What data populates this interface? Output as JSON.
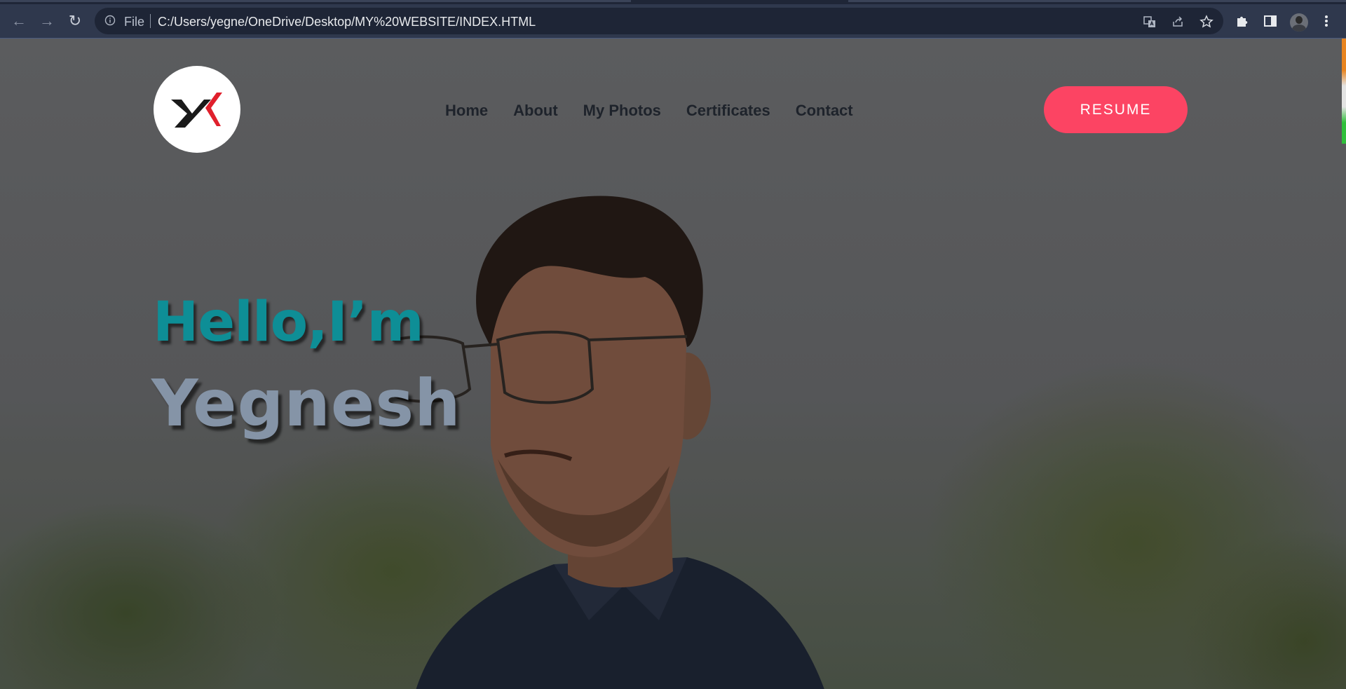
{
  "browser": {
    "back_label": "←",
    "forward_label": "→",
    "reload_label": "↻",
    "scheme_label": "File",
    "url": "C:/Users/yegne/OneDrive/Desktop/MY%20WEBSITE/INDEX.HTML",
    "icons": [
      "back-arrow-icon",
      "forward-arrow-icon",
      "reload-icon",
      "info-icon",
      "translate-icon",
      "share-icon",
      "star-icon",
      "puzzle-icon",
      "side-panel-icon",
      "profile-avatar",
      "kebab-menu-icon"
    ]
  },
  "site": {
    "logo_text": "YK",
    "nav": {
      "home": "Home",
      "about": "About",
      "photos": "My Photos",
      "certificates": "Certificates",
      "contact": "Contact"
    },
    "resume_label": "RESUME",
    "greeting": "Hello,I’m",
    "name": "Yegnesh"
  },
  "colors": {
    "accent_button": "#fc4463",
    "greeting": "#0e8e96",
    "name": "#8594a7",
    "nav_text": "#1e232b"
  }
}
